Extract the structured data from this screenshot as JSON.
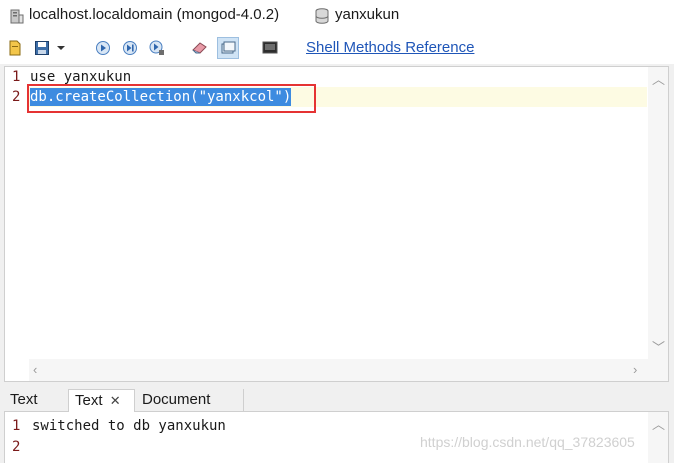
{
  "titlebar": {
    "host_label": "localhost.localdomain (mongod-4.0.2)",
    "db_label": "yanxukun",
    "server_icon": "server-icon",
    "db_icon": "database-icon"
  },
  "toolbar": {
    "buttons": [
      "open-file-icon",
      "save-icon",
      "dropdown-arrow-icon",
      "execute-icon",
      "execute-current-icon",
      "explain-icon",
      "eraser-icon",
      "result-mode-icon",
      "console-icon"
    ],
    "shell_methods_link": "Shell Methods Reference"
  },
  "editor": {
    "lines": [
      {
        "number": "1",
        "text": "use yanxukun"
      },
      {
        "number": "2",
        "text": "db.createCollection(\"yanxkcol\")"
      }
    ]
  },
  "result_tabs": [
    {
      "label": "Text",
      "closable": false
    },
    {
      "label": "Text",
      "closable": true,
      "close_glyph": "✕"
    },
    {
      "label": "Document",
      "closable": false
    }
  ],
  "output": {
    "lines": [
      {
        "number": "1",
        "text": "switched to db yanxukun"
      },
      {
        "number": "2",
        "text": ""
      }
    ]
  },
  "watermark": "https://blog.csdn.net/qq_37823605",
  "colors": {
    "selection": "#3d8be0",
    "highlight_box": "#e53333",
    "link": "#1f56b8",
    "line_number": "#7a1a1a",
    "current_line": "#fdfbe3"
  }
}
